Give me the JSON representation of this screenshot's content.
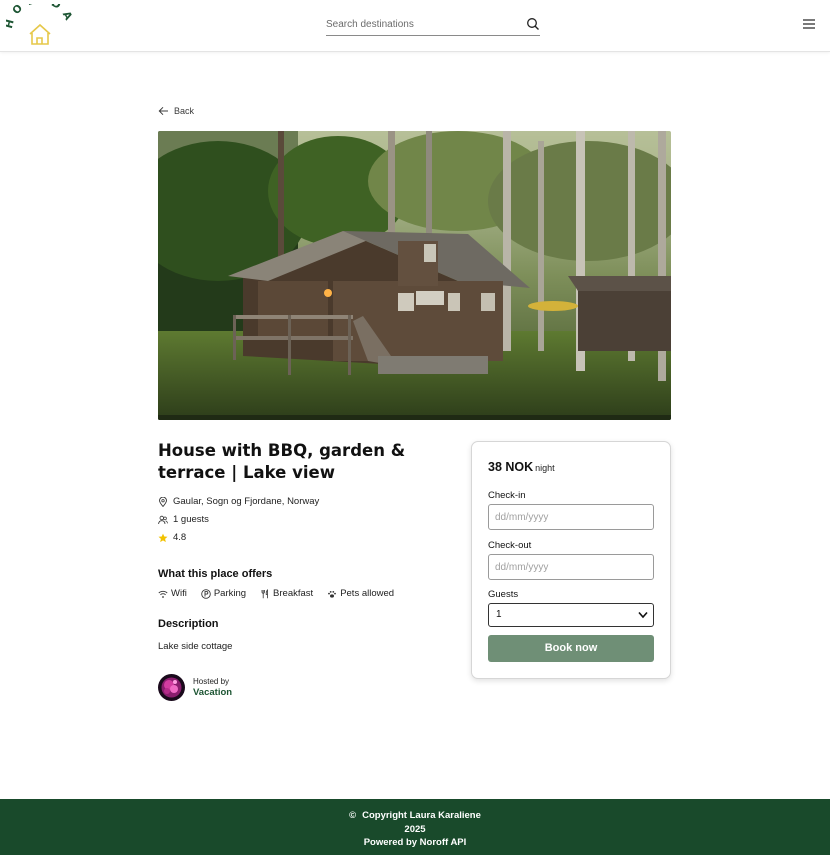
{
  "header": {
    "logo_text": "HOLIDAZE",
    "search": {
      "placeholder": "Search destinations"
    },
    "icons": {
      "search": "search-icon",
      "menu": "hamburger-menu-icon"
    }
  },
  "nav": {
    "back_label": "Back"
  },
  "venue": {
    "title": "House with BBQ, garden & terrace | Lake view",
    "location": "Gaular, Sogn og Fjordane, Norway",
    "guests": "1 guests",
    "rating": "4.8",
    "offers_heading": "What this place offers",
    "amenities": [
      {
        "label": "Wifi",
        "icon": "wifi-icon"
      },
      {
        "label": "Parking",
        "icon": "parking-icon"
      },
      {
        "label": "Breakfast",
        "icon": "fork-knife-icon"
      },
      {
        "label": "Pets allowed",
        "icon": "paw-icon"
      }
    ],
    "description_heading": "Description",
    "description": "Lake side cottage",
    "host": {
      "label": "Hosted by",
      "name": "Vacation"
    }
  },
  "booking": {
    "price": "38 NOK",
    "per": "night",
    "checkin_label": "Check-in",
    "checkin_placeholder": "dd/mm/yyyy",
    "checkout_label": "Check-out",
    "checkout_placeholder": "dd/mm/yyyy",
    "guests_label": "Guests",
    "guests_value": "1",
    "book_label": "Book now"
  },
  "footer": {
    "copyright_symbol": "©",
    "line1": "Copyright Laura Karaliene",
    "line2": "2025",
    "line3": "Powered by Noroff API"
  },
  "colors": {
    "brand_green": "#194a2b",
    "button_green": "#6f8f76",
    "logo_yellow": "#e6c84a",
    "star": "#f2c200"
  }
}
